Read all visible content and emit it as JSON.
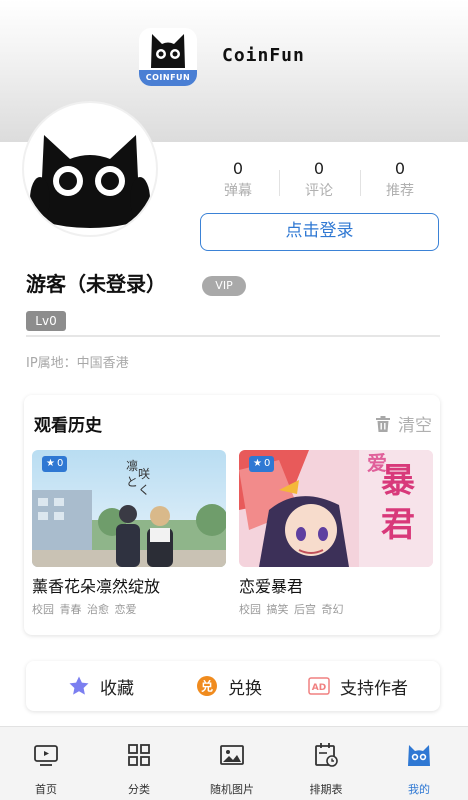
{
  "app": {
    "name": "CoinFun",
    "logo_text": "COINFUN"
  },
  "profile": {
    "stats": [
      {
        "value": "0",
        "label": "弹幕"
      },
      {
        "value": "0",
        "label": "评论"
      },
      {
        "value": "0",
        "label": "推荐"
      }
    ],
    "login_label": "点击登录",
    "name": "游客（未登录）",
    "vip_label": "VIP",
    "level_label": "Lv0",
    "ip_location": "IP属地：中国香港"
  },
  "history": {
    "title": "观看历史",
    "clear_label": "清空",
    "items": [
      {
        "title": "薰香花朵凛然绽放",
        "tags": "校园 青春 治愈 恋爱",
        "badge": "0"
      },
      {
        "title": "恋爱暴君",
        "tags": "校园 搞笑 后宫 奇幻",
        "badge": "0"
      }
    ]
  },
  "actions": [
    {
      "label": "收藏",
      "icon": "star-icon",
      "color": "#7b7ff0"
    },
    {
      "label": "兑换",
      "icon": "exchange-icon",
      "color": "#f08b1e"
    },
    {
      "label": "支持作者",
      "icon": "ad-icon",
      "color": "#f08080"
    }
  ],
  "tabbar": {
    "items": [
      {
        "label": "首页",
        "icon": "tv-icon"
      },
      {
        "label": "分类",
        "icon": "grid-icon"
      },
      {
        "label": "随机图片",
        "icon": "image-icon"
      },
      {
        "label": "排期表",
        "icon": "schedule-icon"
      },
      {
        "label": "我的",
        "icon": "cat-icon"
      }
    ],
    "active_index": 4,
    "active_color": "#2f78d3"
  }
}
